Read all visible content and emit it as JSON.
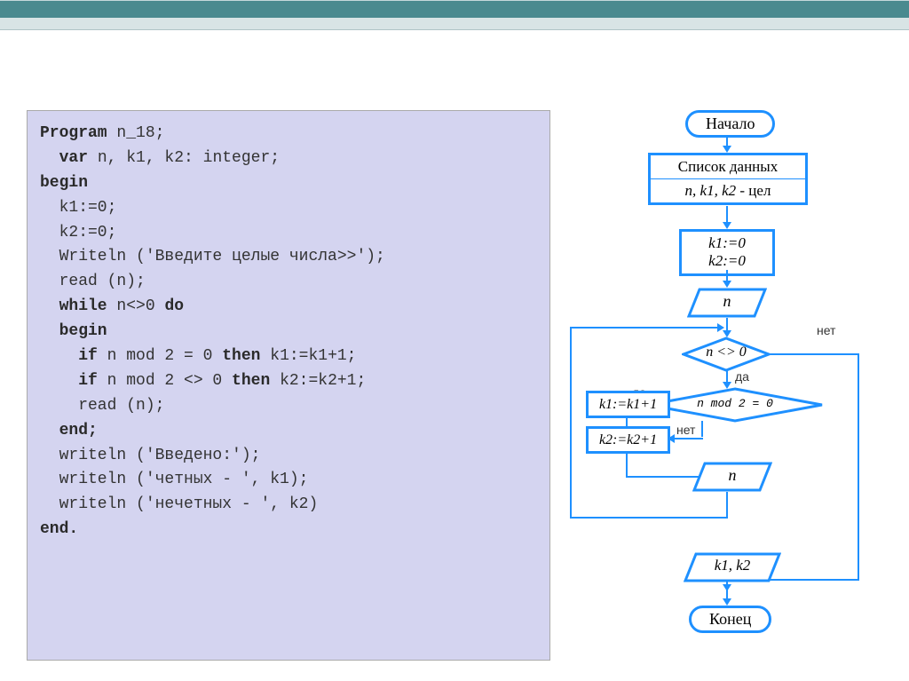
{
  "code": {
    "l1a": "Program",
    "l1b": " n_18;",
    "l2a": "  var",
    "l2b": " n, k1, k2: integer;",
    "l3": "begin",
    "l4": "  k1:=0;",
    "l5": "  k2:=0;",
    "l6": "  Writeln ('Введите целые числа>>');",
    "l7": "  read (n);",
    "l8a": "  while",
    "l8b": " n<>0 ",
    "l8c": "do",
    "l9": "  begin",
    "l10a": "    if",
    "l10b": " n mod 2 = 0 ",
    "l10c": "then",
    "l10d": " k1:=k1+1;",
    "l11a": "    if",
    "l11b": " n mod 2 <> 0 ",
    "l11c": "then",
    "l11d": " k2:=k2+1;",
    "l12": "    read (n);",
    "l13": "  end;",
    "l14": "  writeln ('Введено:');",
    "l15": "  writeln ('четных - ', k1);",
    "l16": "  writeln ('нечетных - ', k2)",
    "l17": "end."
  },
  "flow": {
    "start": "Начало",
    "datalist": "Список данных",
    "vars": "n, k1, k2",
    "vars_suffix": " - цел",
    "init1": "k1:=0",
    "init2": "k2:=0",
    "input_n": "n",
    "cond1": "n <> 0",
    "cond2": "n mod 2 = 0",
    "assign1": "k1:=k1+1",
    "assign2": "k2:=k2+1",
    "input_n2": "n",
    "output": "k1, k2",
    "end": "Конец",
    "yes": "да",
    "no": "нет"
  }
}
